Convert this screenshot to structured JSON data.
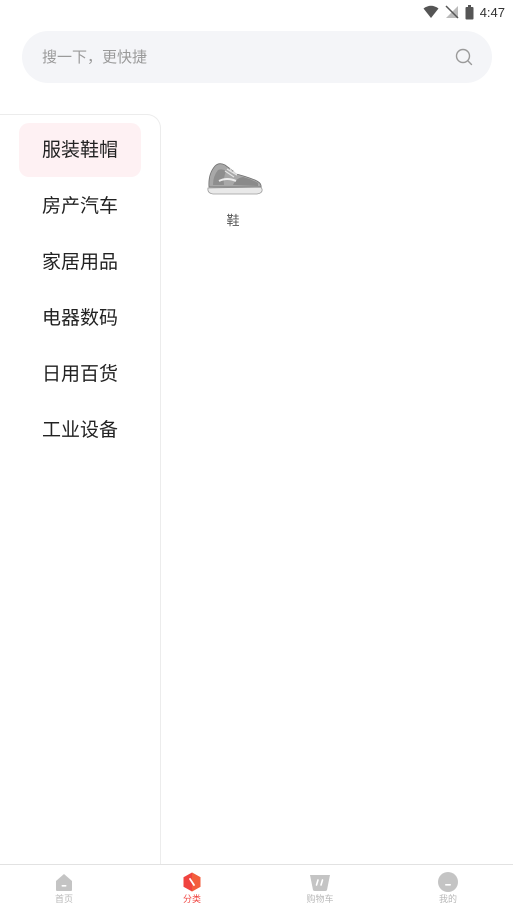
{
  "status_bar": {
    "time": "4:47",
    "icons": [
      "wifi-icon",
      "no-signal-icon",
      "battery-icon"
    ]
  },
  "search": {
    "placeholder": "搜一下，更快捷",
    "icon": "search-icon"
  },
  "categories": [
    {
      "label": "服装鞋帽",
      "active": true
    },
    {
      "label": "房产汽车",
      "active": false
    },
    {
      "label": "家居用品",
      "active": false
    },
    {
      "label": "电器数码",
      "active": false
    },
    {
      "label": "日用百货",
      "active": false
    },
    {
      "label": "工业设备",
      "active": false
    }
  ],
  "products": [
    {
      "label": "鞋",
      "icon": "sneaker-image"
    }
  ],
  "tabbar": {
    "items": [
      {
        "label": "首页",
        "icon": "home-icon",
        "active": false
      },
      {
        "label": "分类",
        "icon": "category-icon",
        "active": true
      },
      {
        "label": "购物车",
        "icon": "cart-icon",
        "active": false
      },
      {
        "label": "我的",
        "icon": "profile-icon",
        "active": false
      }
    ]
  },
  "colors": {
    "accent": "#f0433f",
    "active_category_bg": "#fef1f3",
    "search_bg": "#f4f5f8",
    "inactive_tab": "#b8b8b8"
  }
}
